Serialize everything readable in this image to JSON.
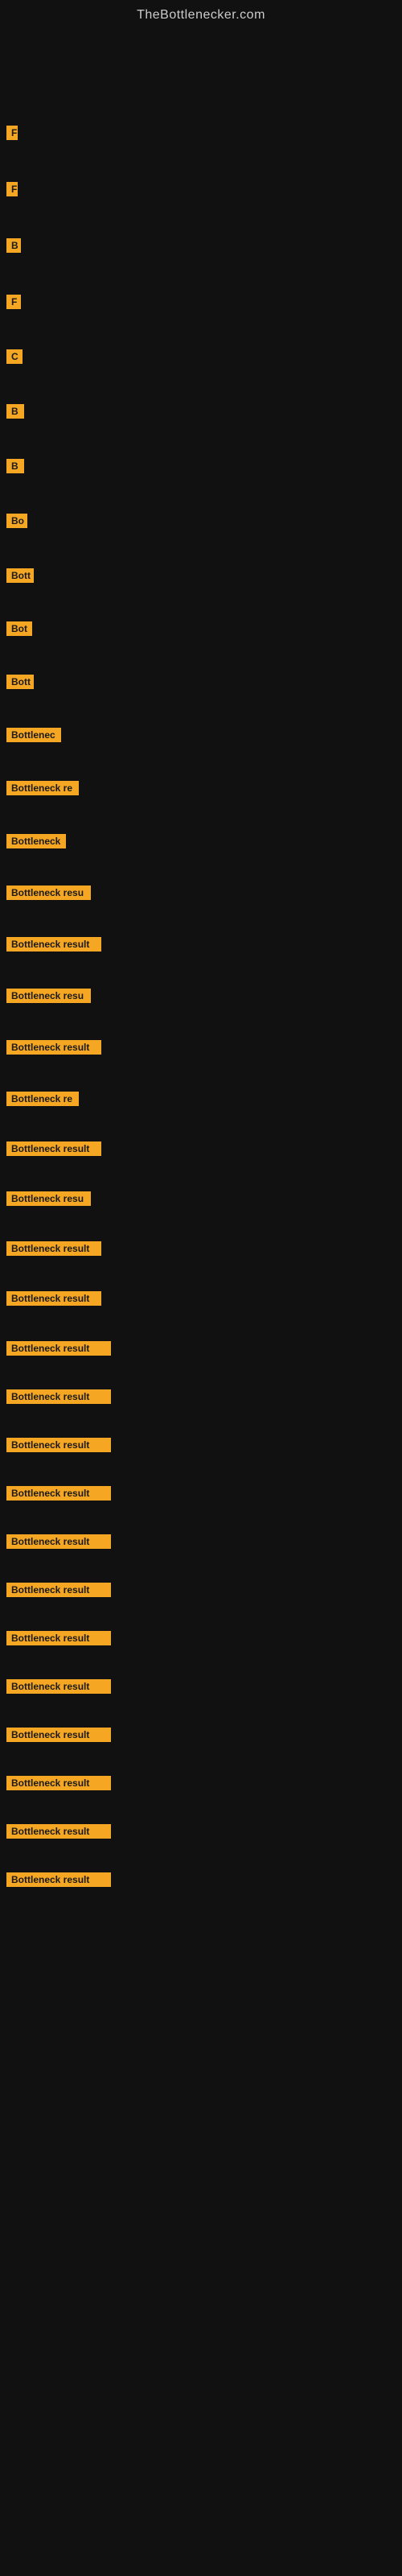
{
  "header": {
    "title": "TheBottlenecker.com"
  },
  "items": [
    {
      "label": "",
      "width": 4
    },
    {
      "label": "",
      "width": 4
    },
    {
      "label": "F",
      "width": 14
    },
    {
      "label": "F",
      "width": 14
    },
    {
      "label": "B",
      "width": 18
    },
    {
      "label": "F",
      "width": 18
    },
    {
      "label": "C",
      "width": 20
    },
    {
      "label": "B",
      "width": 22
    },
    {
      "label": "B",
      "width": 22
    },
    {
      "label": "Bo",
      "width": 26
    },
    {
      "label": "Bott",
      "width": 34
    },
    {
      "label": "Bot",
      "width": 32
    },
    {
      "label": "Bott",
      "width": 34
    },
    {
      "label": "Bottlenec",
      "width": 68
    },
    {
      "label": "Bottleneck re",
      "width": 90
    },
    {
      "label": "Bottleneck",
      "width": 74
    },
    {
      "label": "Bottleneck resu",
      "width": 105
    },
    {
      "label": "Bottleneck result",
      "width": 118
    },
    {
      "label": "Bottleneck resu",
      "width": 105
    },
    {
      "label": "Bottleneck result",
      "width": 118
    },
    {
      "label": "Bottleneck re",
      "width": 90
    },
    {
      "label": "Bottleneck result",
      "width": 118
    },
    {
      "label": "Bottleneck resu",
      "width": 105
    },
    {
      "label": "Bottleneck result",
      "width": 118
    },
    {
      "label": "Bottleneck result",
      "width": 118
    },
    {
      "label": "Bottleneck result",
      "width": 130
    },
    {
      "label": "Bottleneck result",
      "width": 130
    },
    {
      "label": "Bottleneck result",
      "width": 130
    },
    {
      "label": "Bottleneck result",
      "width": 130
    },
    {
      "label": "Bottleneck result",
      "width": 130
    },
    {
      "label": "Bottleneck result",
      "width": 130
    },
    {
      "label": "Bottleneck result",
      "width": 130
    },
    {
      "label": "Bottleneck result",
      "width": 130
    },
    {
      "label": "Bottleneck result",
      "width": 130
    },
    {
      "label": "Bottleneck result",
      "width": 130
    },
    {
      "label": "Bottleneck result",
      "width": 130
    },
    {
      "label": "Bottleneck result",
      "width": 130
    }
  ]
}
